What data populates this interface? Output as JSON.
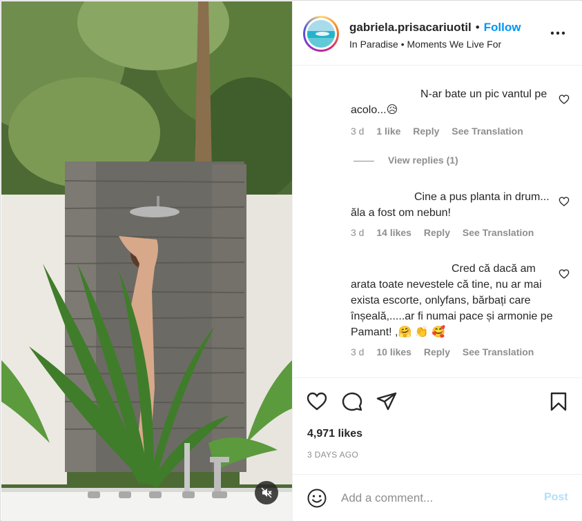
{
  "post": {
    "username": "gabriela.prisacariuotil",
    "separator": "•",
    "follow_label": "Follow",
    "location": "In Paradise • Moments We Live For",
    "likes": "4,971 likes",
    "date": "3 DAYS AGO"
  },
  "comments": [
    {
      "text": "N-ar bate un pic vantul pe acolo...😥",
      "time": "3 d",
      "likes": "1 like",
      "reply_label": "Reply",
      "translate_label": "See Translation"
    },
    {
      "text": "Cine a pus planta in drum... ăla a fost om nebun!",
      "time": "3 d",
      "likes": "14 likes",
      "reply_label": "Reply",
      "translate_label": "See Translation"
    },
    {
      "text": "Cred că dacă am arata toate nevestele că tine, nu ar mai exista escorte, onlyfans, bărbați care înșeală,.....ar fi numai pace și armonie pe Pamant! ,🤗 👏 🥰",
      "time": "3 d",
      "likes": "10 likes",
      "reply_label": "Reply",
      "translate_label": "See Translation"
    }
  ],
  "view_replies": "View replies (1)",
  "composer": {
    "placeholder": "Add a comment...",
    "post_label": "Post"
  },
  "icons": {
    "more": "more-options-icon",
    "like": "heart-icon",
    "comment": "comment-bubble-icon",
    "share": "paper-plane-icon",
    "save": "bookmark-icon",
    "emoji": "smiley-icon",
    "mute": "speaker-muted-icon"
  },
  "colors": {
    "accent": "#0095f6",
    "post_disabled": "#b2dffc",
    "muted_text": "#8e8e8e"
  }
}
